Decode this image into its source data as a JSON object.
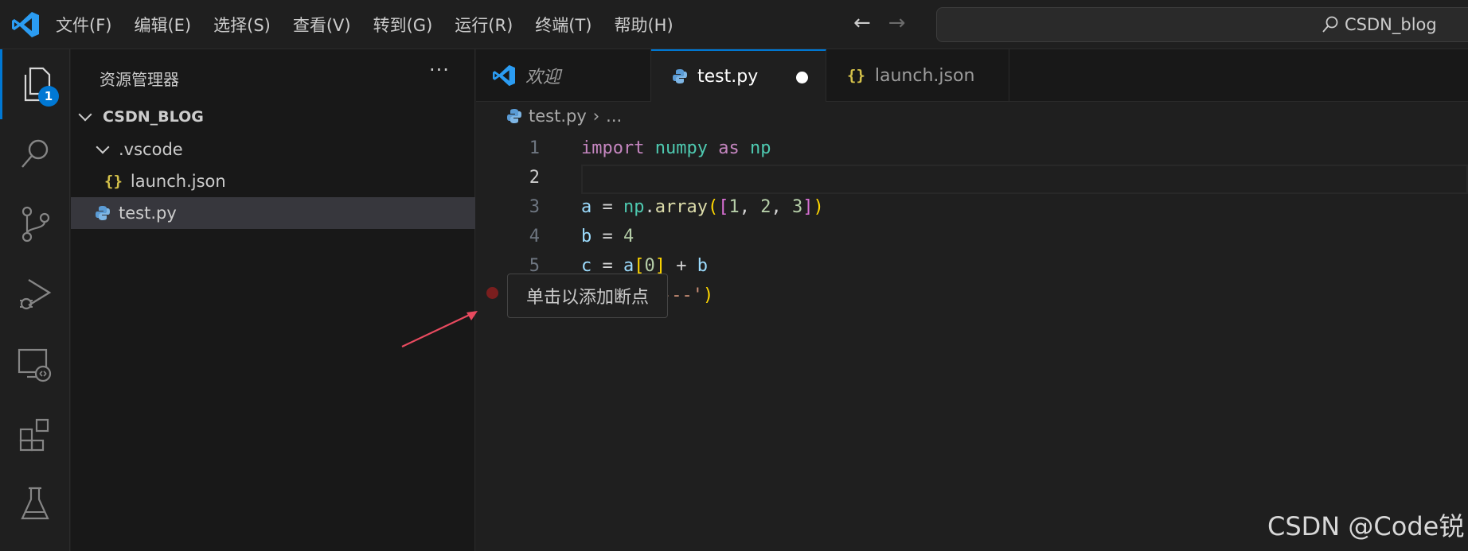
{
  "titlebar": {
    "menu": [
      "文件(F)",
      "编辑(E)",
      "选择(S)",
      "查看(V)",
      "转到(G)",
      "运行(R)",
      "终端(T)",
      "帮助(H)"
    ],
    "search_text": "CSDN_blog"
  },
  "activity": {
    "explorer_badge": "1"
  },
  "sidebar": {
    "title": "资源管理器",
    "more": "···",
    "root": "CSDN_BLOG",
    "folder": ".vscode",
    "json_icon": "{}",
    "files": [
      "launch.json",
      "test.py"
    ]
  },
  "tabs": [
    {
      "label": "欢迎"
    },
    {
      "label": "test.py"
    },
    {
      "label": "launch.json"
    }
  ],
  "breadcrumb": {
    "file": "test.py",
    "sep": "›",
    "rest": "..."
  },
  "editor": {
    "line_numbers": [
      "1",
      "2",
      "3",
      "4",
      "5"
    ],
    "visible_partial_code": "---')"
  },
  "tooltip": "单击以添加断点",
  "watermark": "CSDN @Code锐",
  "colors": {
    "accent": "#0078d4",
    "breakpoint": "#7a1e1e",
    "arrow": "#e84a5f"
  }
}
